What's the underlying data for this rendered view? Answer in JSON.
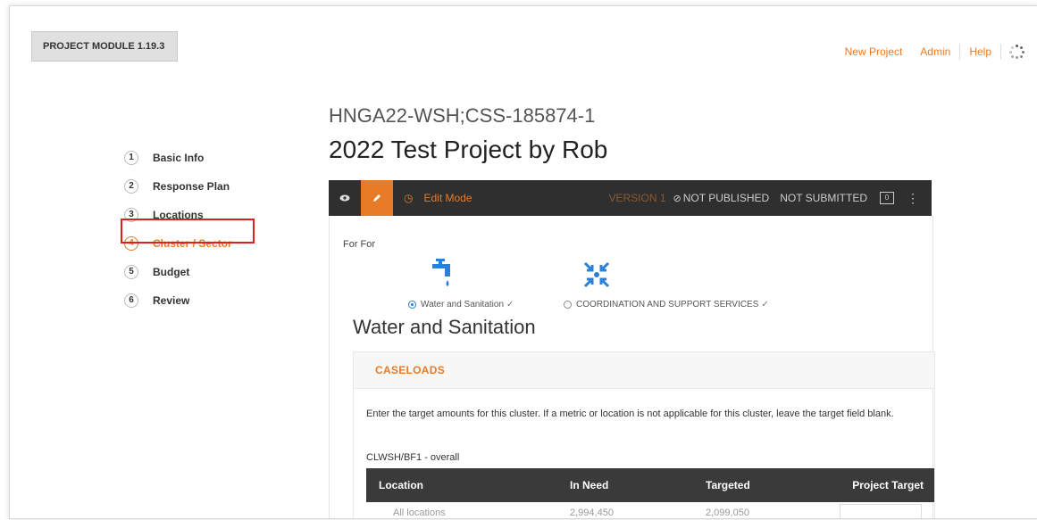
{
  "header": {
    "module_label": "PROJECT MODULE 1.19.3",
    "nav": [
      "New Project",
      "Admin",
      "Help"
    ]
  },
  "steps": [
    {
      "num": "1",
      "label": "Basic Info"
    },
    {
      "num": "2",
      "label": "Response Plan"
    },
    {
      "num": "3",
      "label": "Locations"
    },
    {
      "num": "4",
      "label": "Cluster / Sector"
    },
    {
      "num": "5",
      "label": "Budget"
    },
    {
      "num": "6",
      "label": "Review"
    }
  ],
  "active_step_index": 3,
  "project": {
    "code": "HNGA22-WSH;CSS-185874-1",
    "title": "2022 Test Project by Rob"
  },
  "toolbar": {
    "edit_mode": "Edit Mode",
    "version": "VERSION 1",
    "published": "NOT PUBLISHED",
    "submitted": "NOT SUBMITTED",
    "message_count": "0",
    "more": "⋮"
  },
  "cluster_select": {
    "label": "For For",
    "options": [
      {
        "label": "Water and Sanitation",
        "selected": true,
        "icon": "water-tap-icon"
      },
      {
        "label": "COORDINATION AND SUPPORT SERVICES",
        "selected": false,
        "icon": "coordination-arrows-icon"
      }
    ]
  },
  "section_title": "Water and Sanitation",
  "caseloads": {
    "heading": "CASELOADS",
    "instructions": "Enter the target amounts for this cluster. If a metric or location is not applicable for this cluster, leave the target field blank.",
    "metric_label": "CLWSH/BF1 - overall",
    "columns": [
      "Location",
      "In Need",
      "Targeted",
      "Project Target"
    ],
    "partial_row": [
      "All locations",
      "2,994,450",
      "2,099,050",
      ""
    ]
  },
  "colors": {
    "accent": "#e77b27",
    "toolbar_bg": "#2f2f2f",
    "highlight_border": "#e02020"
  }
}
